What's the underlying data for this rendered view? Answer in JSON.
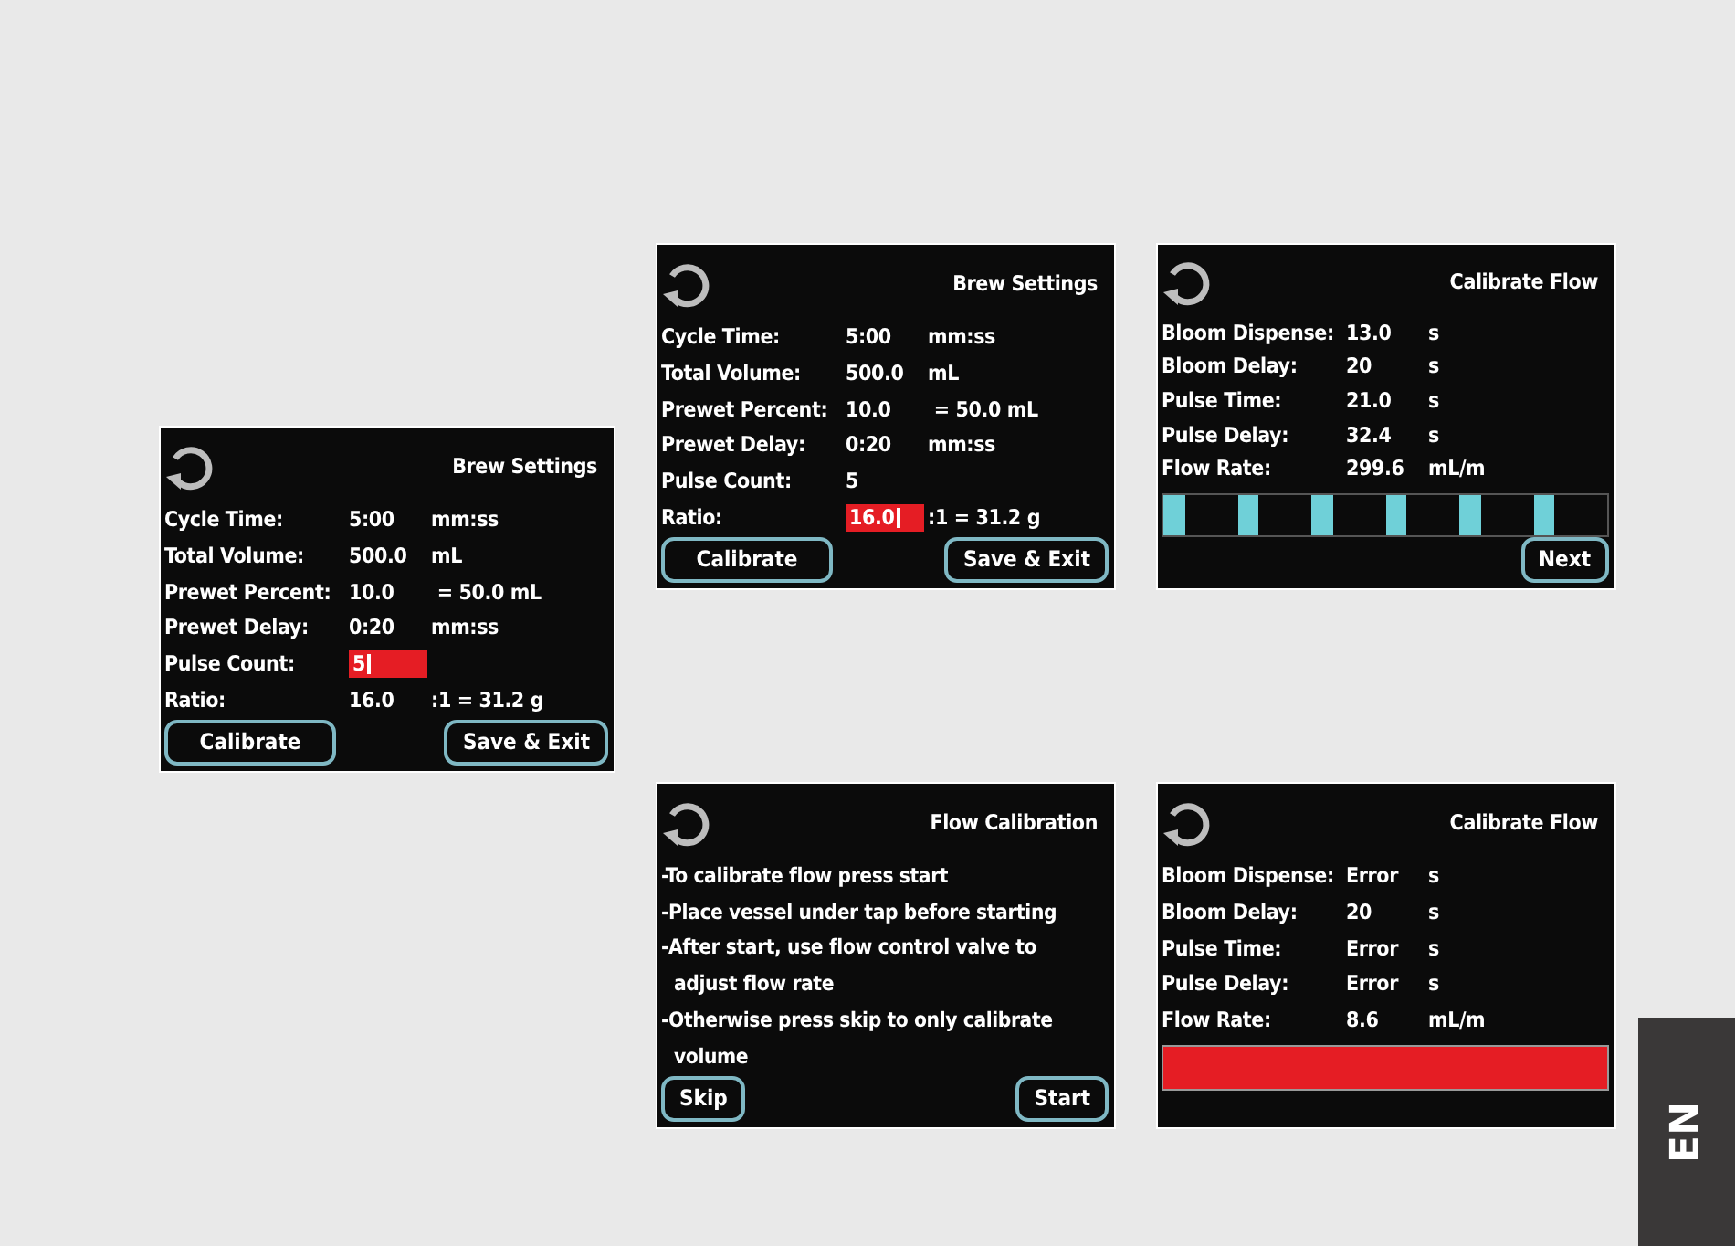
{
  "screens": [
    {
      "kind": "settings",
      "title": "Brew Settings",
      "rows": [
        {
          "label": "Cycle Time:",
          "value": "5:00",
          "unit": "mm:ss",
          "selected": false
        },
        {
          "label": "Total Volume:",
          "value": "500.0",
          "unit": "mL",
          "selected": false
        },
        {
          "label": "Prewet Percent:",
          "value": "10.0",
          "unit": " = 50.0 mL",
          "selected": false
        },
        {
          "label": "Prewet Delay:",
          "value": "0:20",
          "unit": "mm:ss",
          "selected": false
        },
        {
          "label": "Pulse Count:",
          "value": "5",
          "selected": true
        },
        {
          "label": "Ratio:",
          "value": "16.0",
          "unit": ":1 = 31.2 g",
          "selected": false
        }
      ],
      "buttons": [
        "Calibrate",
        "Save & Exit"
      ]
    },
    {
      "kind": "settings",
      "title": "Brew Settings",
      "rows": [
        {
          "label": "Cycle Time:",
          "value": "5:00",
          "unit": "mm:ss",
          "selected": false
        },
        {
          "label": "Total Volume:",
          "value": "500.0",
          "unit": "mL",
          "selected": false
        },
        {
          "label": "Prewet Percent:",
          "value": "10.0",
          "unit": " = 50.0 mL",
          "selected": false
        },
        {
          "label": "Prewet Delay:",
          "value": "0:20",
          "unit": "mm:ss",
          "selected": false
        },
        {
          "label": "Pulse Count:",
          "value": "5",
          "selected": false
        },
        {
          "label": "Ratio:",
          "value": "16.0",
          "unit": ":1 = 31.2 g",
          "selected": true
        }
      ],
      "buttons": [
        "Calibrate",
        "Save & Exit"
      ]
    },
    {
      "kind": "calibrate",
      "title": "Calibrate Flow",
      "rows": [
        {
          "label": "Bloom Dispense:",
          "value": "13.0",
          "unit": "s"
        },
        {
          "label": "Bloom Delay:",
          "value": "20",
          "unit": "s"
        },
        {
          "label": "Pulse Time:",
          "value": "21.0",
          "unit": "s"
        },
        {
          "label": "Pulse Delay:",
          "value": "32.4",
          "unit": "s"
        },
        {
          "label": "Flow Rate:",
          "value": "299.6",
          "unit": "mL/m"
        }
      ],
      "flow_bar": {
        "error": false
      },
      "buttons": [
        "Next"
      ]
    },
    {
      "kind": "instructions",
      "title": "Flow Calibration",
      "lines": [
        "-To calibrate flow press start",
        "-Place vessel under tap before starting",
        "-After start, use flow control valve to adjust flow rate",
        "-Otherwise press skip to only calibrate volume"
      ],
      "buttons": [
        "Skip",
        "Start"
      ]
    },
    {
      "kind": "calibrate",
      "title": "Calibrate Flow",
      "rows": [
        {
          "label": "Bloom Dispense:",
          "value": "Error",
          "unit": "s"
        },
        {
          "label": "Bloom Delay:",
          "value": "20",
          "unit": "s"
        },
        {
          "label": "Pulse Time:",
          "value": "Error",
          "unit": "s"
        },
        {
          "label": "Pulse Delay:",
          "value": "Error",
          "unit": "s"
        },
        {
          "label": "Flow Rate:",
          "value": "8.6",
          "unit": "mL/m"
        }
      ],
      "flow_bar": {
        "error": true
      }
    }
  ],
  "language_tab": "EN"
}
